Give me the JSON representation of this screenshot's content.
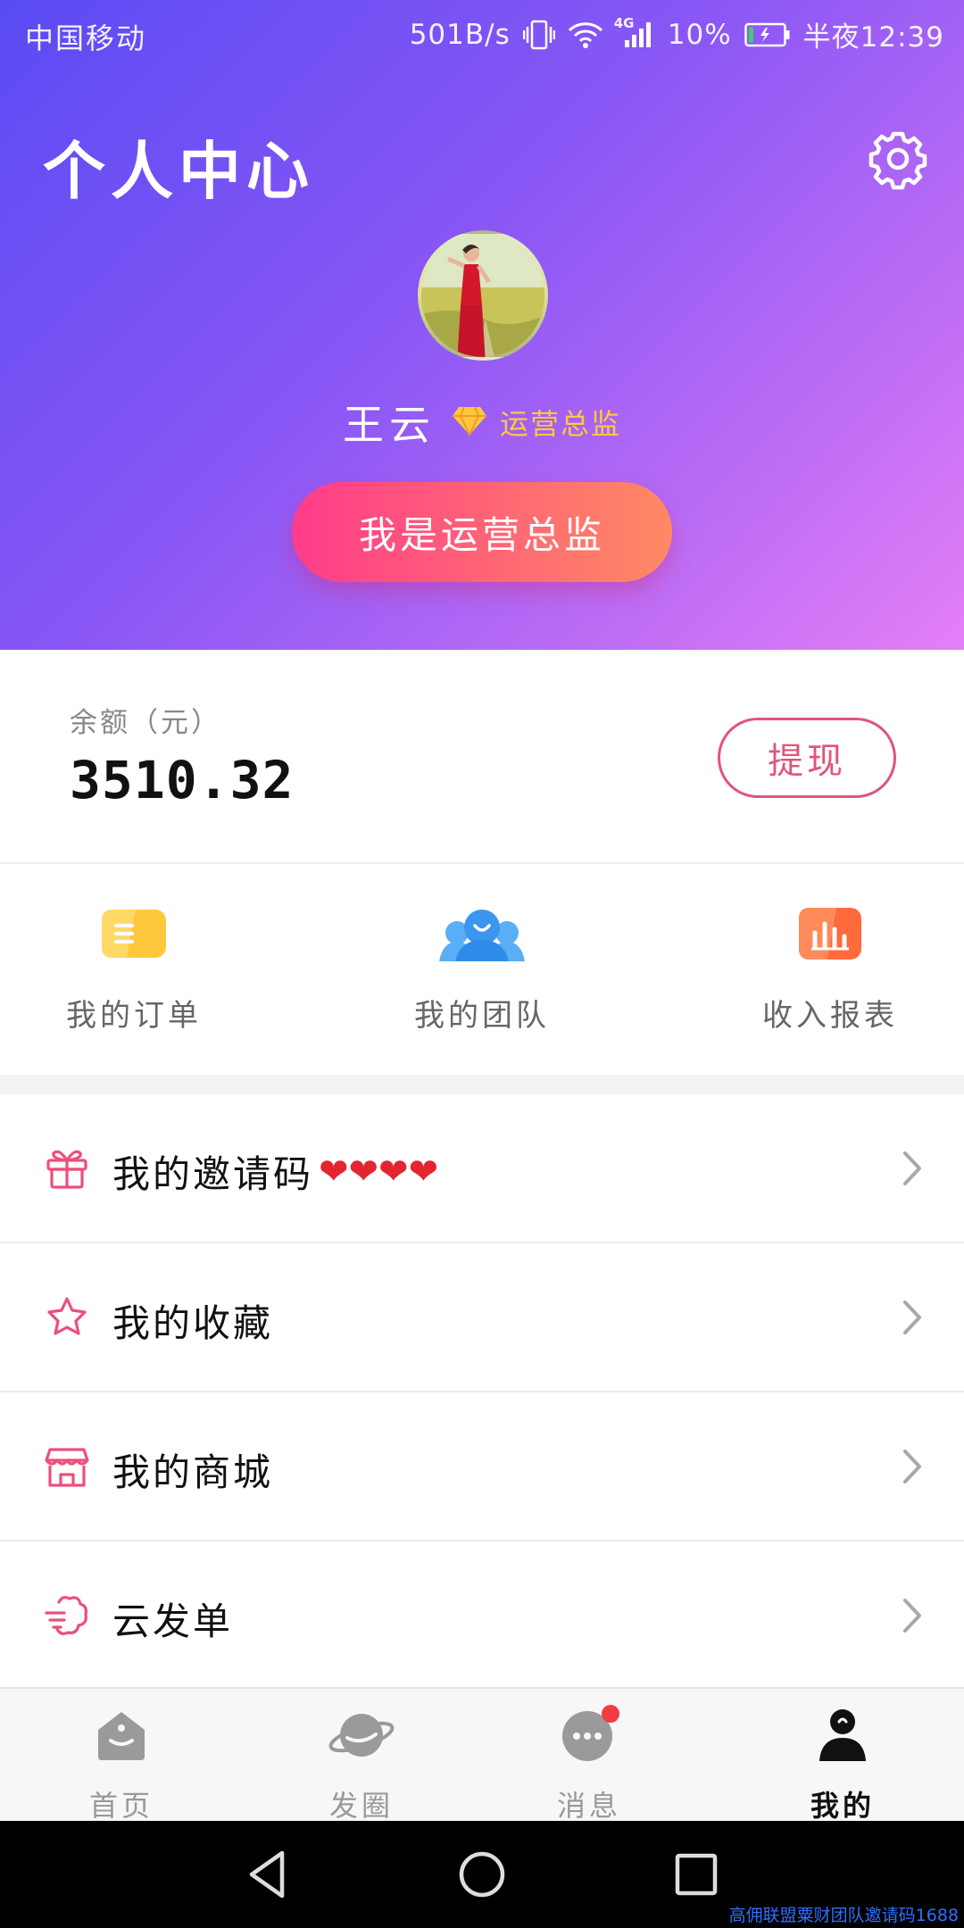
{
  "status_bar": {
    "carrier": "中国移动",
    "speed": "501B/s",
    "network": "4G",
    "battery": "10%",
    "time": "半夜12:39"
  },
  "header": {
    "title": "个人中心",
    "settings_icon": "gear-icon"
  },
  "profile": {
    "name": "王云",
    "role_icon": "diamond-icon",
    "role": "运营总监",
    "primary_button": "我是运营总监"
  },
  "balance": {
    "label": "余额（元）",
    "value": "3510.32",
    "withdraw_button": "提现"
  },
  "quick_actions": [
    {
      "label": "我的订单",
      "icon": "orders-icon",
      "color": "#ffc83c"
    },
    {
      "label": "我的团队",
      "icon": "team-icon",
      "color": "#3a9bf0"
    },
    {
      "label": "收入报表",
      "icon": "report-icon",
      "color": "#ff6a3d"
    }
  ],
  "menu": [
    {
      "label": "我的邀请码",
      "suffix": "❤❤❤❤",
      "icon": "gift-icon"
    },
    {
      "label": "我的收藏",
      "icon": "star-icon"
    },
    {
      "label": "我的商城",
      "icon": "shop-icon"
    },
    {
      "label": "云发单",
      "icon": "cloud-icon"
    }
  ],
  "tabs": [
    {
      "label": "首页",
      "icon": "home-icon",
      "active": false
    },
    {
      "label": "发圈",
      "icon": "planet-icon",
      "active": false
    },
    {
      "label": "消息",
      "icon": "message-icon",
      "active": false,
      "badge": true
    },
    {
      "label": "我的",
      "icon": "user-icon",
      "active": true
    }
  ],
  "watermark": "高佣联盟粟财团队邀请码1688",
  "colors": {
    "accent_pink": "#e0557a",
    "button_gradient_start": "#ff3c8a",
    "button_gradient_end": "#ff8a63",
    "gold": "#ffc83c"
  }
}
